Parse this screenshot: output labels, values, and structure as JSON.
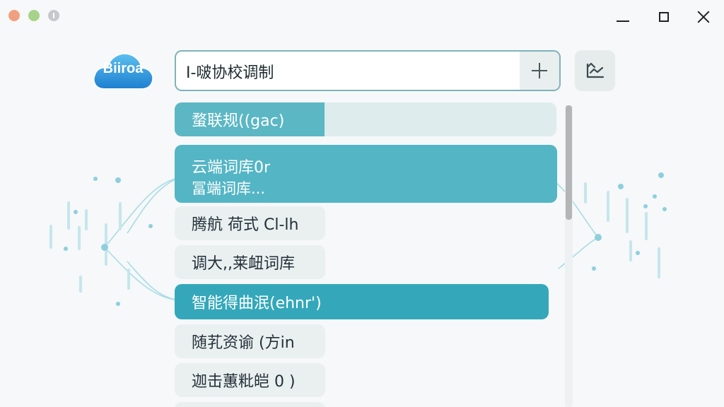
{
  "app": {
    "logo_text": "Biiroa"
  },
  "search": {
    "value": "I-啵协校调制",
    "add_label": "+"
  },
  "suggestions": [
    {
      "label": "蝥联规((gac)"
    },
    {
      "label": "云端词库0r",
      "sub": "冨端词库..."
    },
    {
      "label": "腾航 荷式 Cl-lh"
    },
    {
      "label": "调大,,莱衄词库"
    },
    {
      "label": "智能得曲泯(ehnr')"
    },
    {
      "label": "随芤资谕 (方in"
    },
    {
      "label": "迦击蕙粃皑 0 )"
    }
  ],
  "colors": {
    "accent": "#4fb3c3",
    "accent_strong": "#2fa6b8",
    "item_bg": "#eaf0f0"
  },
  "icons": [
    "close-window-icon",
    "minimize-icon",
    "maximize-icon",
    "plus-icon",
    "upload-graph-icon",
    "cloud-logo-icon"
  ]
}
